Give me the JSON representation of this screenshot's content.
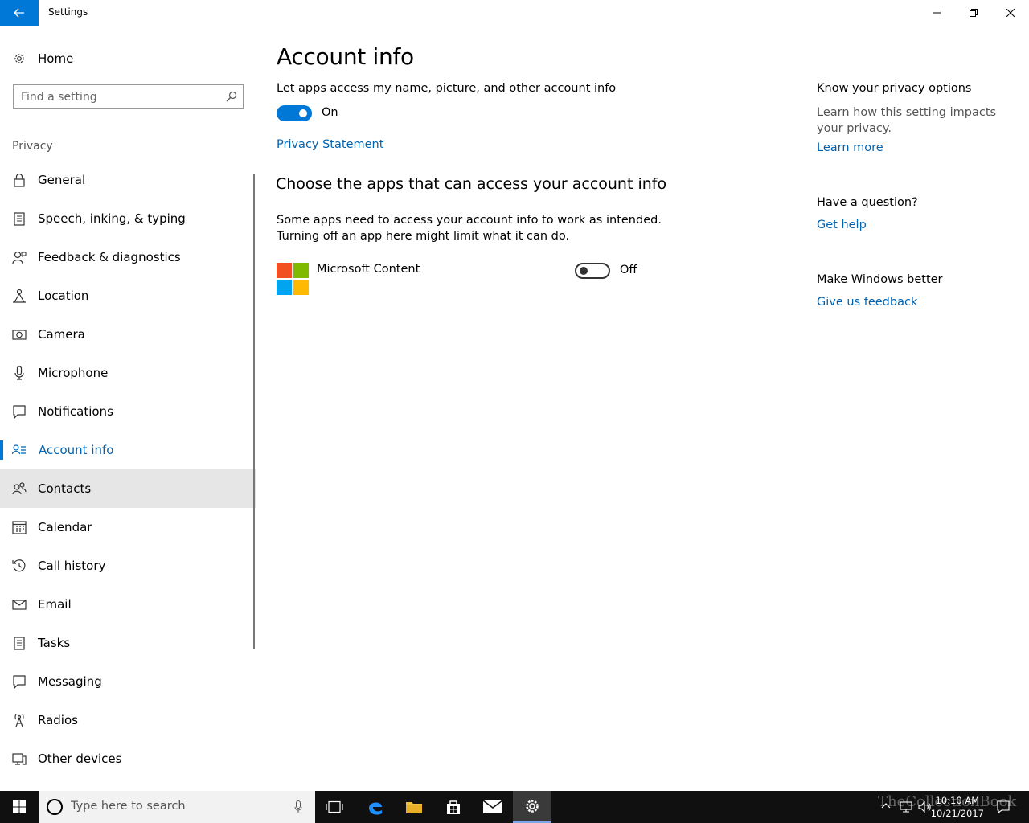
{
  "window": {
    "title": "Settings",
    "back_icon": "arrow-left-icon",
    "controls": [
      "minimize-icon",
      "restore-icon",
      "close-icon"
    ]
  },
  "sidebar": {
    "home_label": "Home",
    "search_placeholder": "Find a setting",
    "section_label": "Privacy",
    "items": [
      {
        "label": "General",
        "icon": "lock-icon"
      },
      {
        "label": "Speech, inking, & typing",
        "icon": "clipboard-icon"
      },
      {
        "label": "Feedback & diagnostics",
        "icon": "person-feedback-icon"
      },
      {
        "label": "Location",
        "icon": "location-icon"
      },
      {
        "label": "Camera",
        "icon": "camera-icon"
      },
      {
        "label": "Microphone",
        "icon": "microphone-icon"
      },
      {
        "label": "Notifications",
        "icon": "notification-icon"
      },
      {
        "label": "Account info",
        "icon": "account-info-icon",
        "active": true
      },
      {
        "label": "Contacts",
        "icon": "contacts-icon",
        "hover": true
      },
      {
        "label": "Calendar",
        "icon": "calendar-icon"
      },
      {
        "label": "Call history",
        "icon": "history-icon"
      },
      {
        "label": "Email",
        "icon": "email-icon"
      },
      {
        "label": "Tasks",
        "icon": "tasks-icon"
      },
      {
        "label": "Messaging",
        "icon": "messaging-icon"
      },
      {
        "label": "Radios",
        "icon": "radio-tower-icon"
      },
      {
        "label": "Other devices",
        "icon": "devices-icon"
      }
    ]
  },
  "main": {
    "title": "Account info",
    "access_label": "Let apps access my name, picture, and other account info",
    "access_state": "On",
    "privacy_link": "Privacy Statement",
    "section_title": "Choose the apps that can access your account info",
    "description": "Some apps need to access your account info to work as intended. Turning off an app here might limit what it can do.",
    "apps": [
      {
        "name": "Microsoft Content",
        "state": "Off"
      }
    ]
  },
  "right": {
    "privacy_heading": "Know your privacy options",
    "privacy_desc": "Learn how this setting impacts your privacy.",
    "learn_more": "Learn more",
    "question_heading": "Have a question?",
    "get_help": "Get help",
    "better_heading": "Make Windows better",
    "feedback": "Give us feedback"
  },
  "taskbar": {
    "search_placeholder": "Type here to search",
    "time": "10:10 AM",
    "date": "10/21/2017",
    "watermark": "TheCollectionBook",
    "colors": {
      "background": "#101010",
      "accent": "#0078d7"
    }
  }
}
